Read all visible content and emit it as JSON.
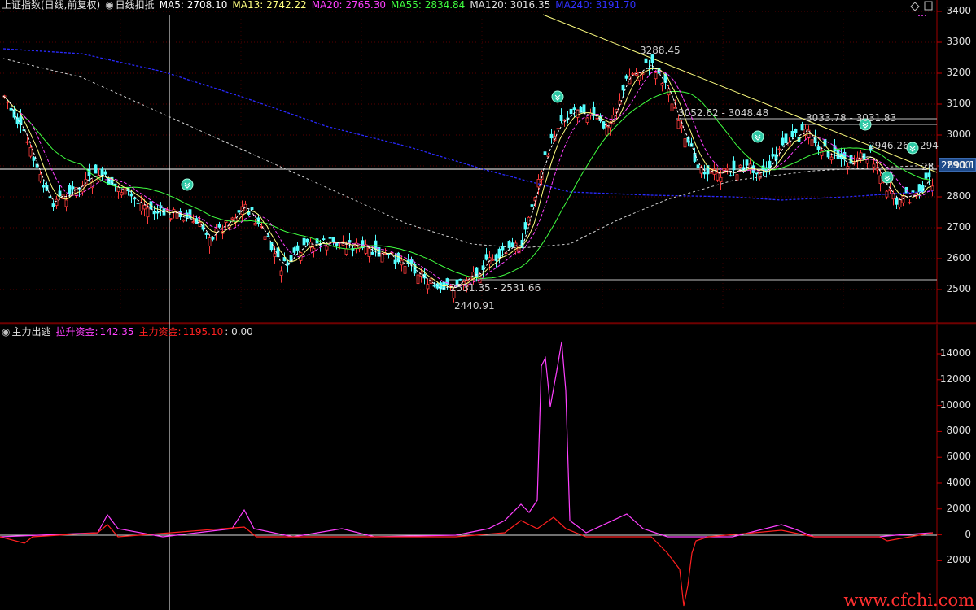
{
  "header_top": {
    "title": "上证指数(日线,前复权)",
    "indicator_name": "日线扣抵",
    "ma5": "MA5: 2708.10",
    "ma13": "MA13: 2742.22",
    "ma20": "MA20: 2765.30",
    "ma55": "MA55: 2834.84",
    "ma120": "MA120: 3016.35",
    "ma240": "MA240: 3191.70"
  },
  "header_bottom": {
    "indicator_name": "主力出逃",
    "lashen_label": "拉升资金:",
    "lashen_value": "142.35",
    "zhuli_label": "主力资金:",
    "zhuli_value": "1195.10",
    "extra_value": ": 0.00"
  },
  "annotations": {
    "high": "3288.45",
    "low": "2440.91",
    "range_low": "2531.35 - 2531.66",
    "range_mid": "3052.62 - 3048.48",
    "range_right": "3033.78 - 3031.83",
    "range_right2": "2946.26",
    "range_right2b": "294",
    "range_right3": "28",
    "current_price": "2890.1"
  },
  "price_axis": [
    "3400",
    "3300",
    "3200",
    "3100",
    "3000",
    "2900",
    "2800",
    "2700",
    "2600",
    "2500"
  ],
  "volume_axis": [
    "14000",
    "12000",
    "10000",
    "8000",
    "6000",
    "4000",
    "2000",
    "0",
    "-2000"
  ],
  "watermark": "www.cfchi.com",
  "colors": {
    "up": "#ff3b3b",
    "down": "#54ffff",
    "ma5": "#ffffff",
    "ma13": "#ffff80",
    "ma20": "#ff40ff",
    "ma55": "#40ff40",
    "ma120": "#d0d0d0",
    "ma240": "#2a2aff",
    "lashen": "#ff40ff",
    "zhuli": "#ff2020"
  }
}
